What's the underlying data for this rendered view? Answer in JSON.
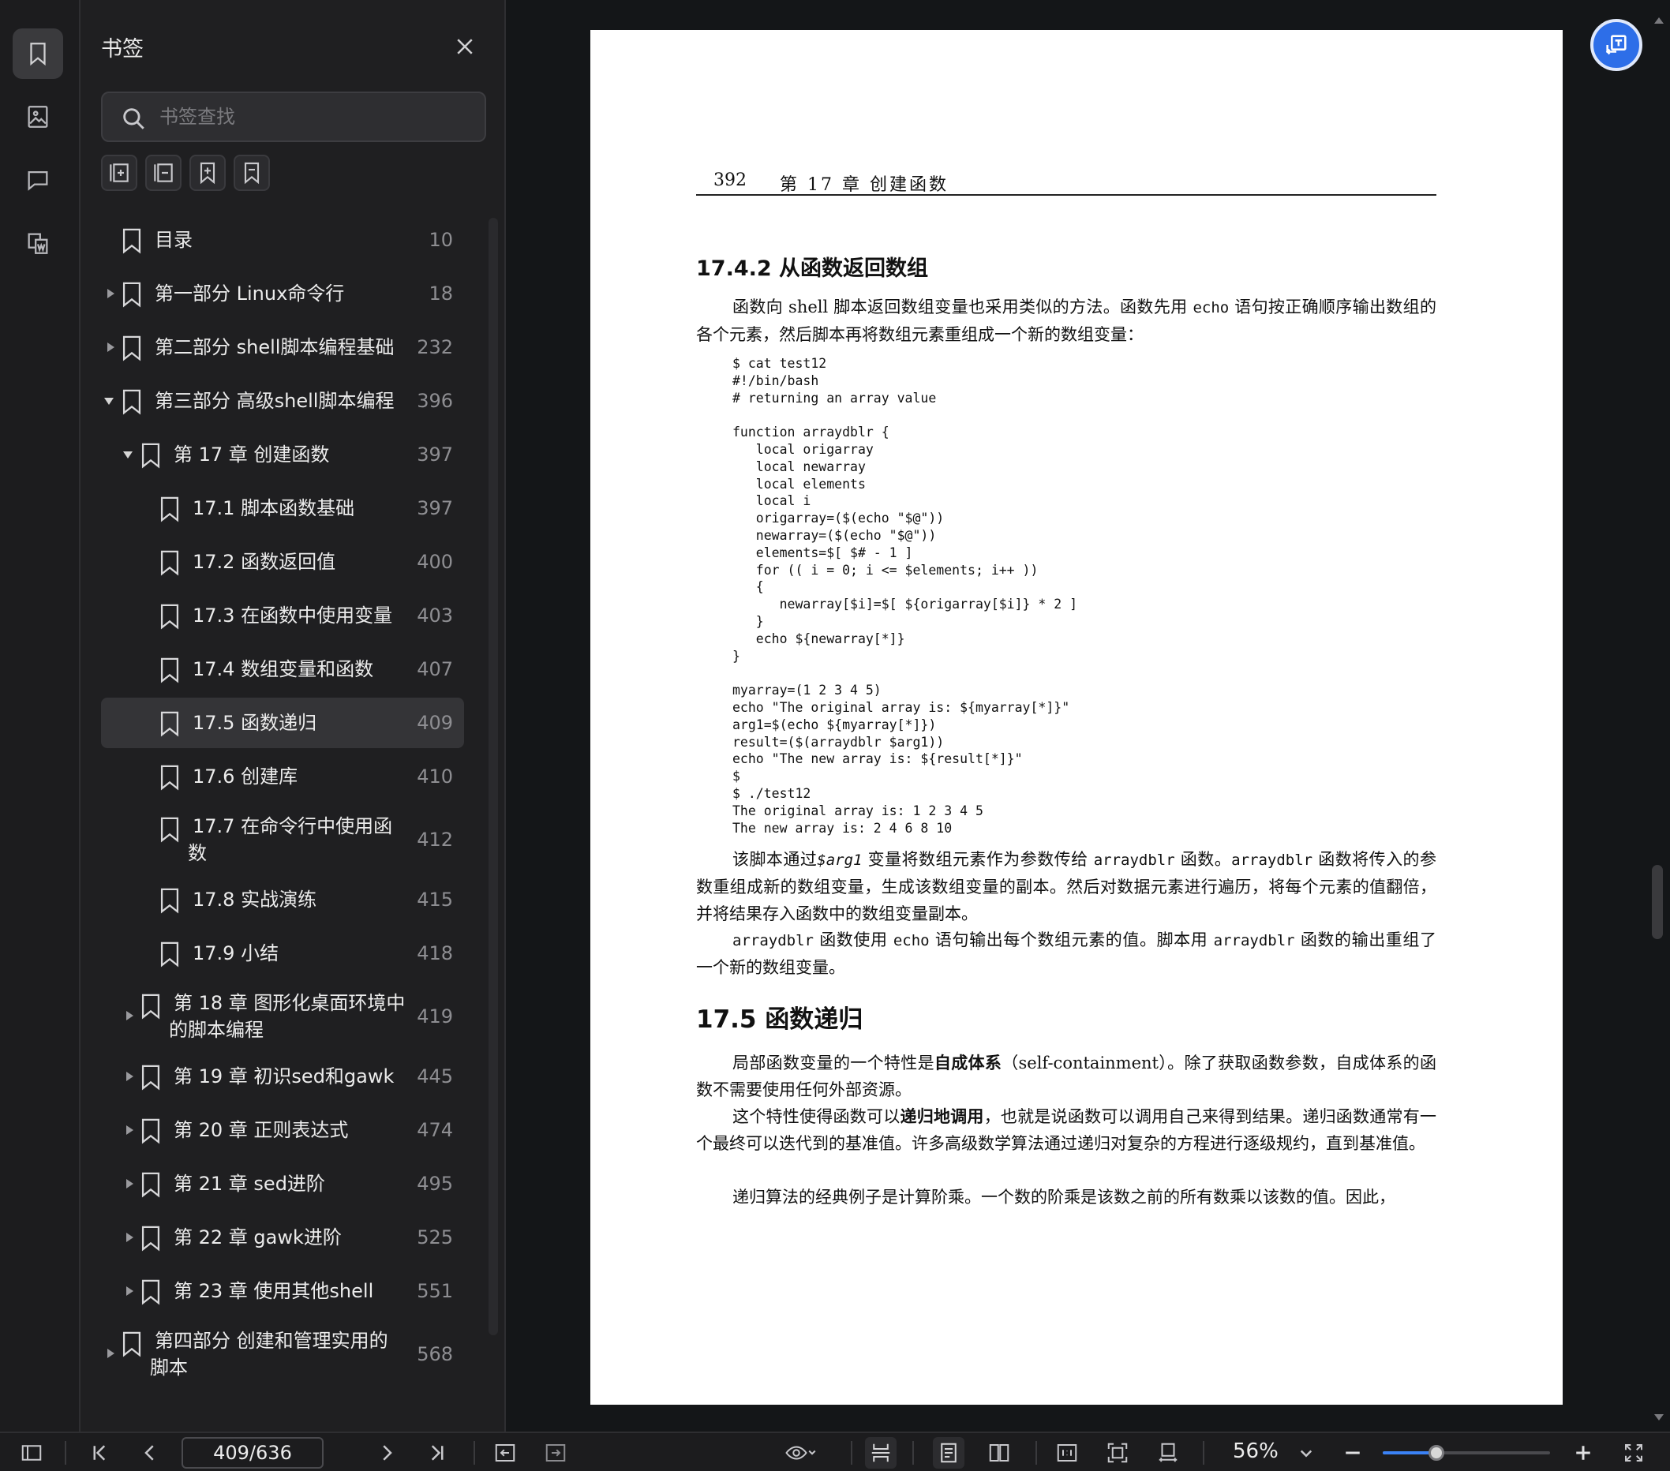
{
  "panel": {
    "title": "书签",
    "search_placeholder": "书签查找"
  },
  "bookmarks": [
    {
      "label": "目录",
      "page": "10",
      "level": 0,
      "arrow": "none"
    },
    {
      "label": "第一部分 Linux命令行",
      "page": "18",
      "level": 0,
      "arrow": "right"
    },
    {
      "label": " 第二部分 shell脚本编程基础",
      "page": "232",
      "level": 0,
      "arrow": "right"
    },
    {
      "label": " 第三部分 高级shell脚本编程",
      "page": "396",
      "level": 0,
      "arrow": "down"
    },
    {
      "label": "第 17 章 创建函数",
      "page": "397",
      "level": 1,
      "arrow": "down"
    },
    {
      "label": "17.1 脚本函数基础",
      "page": "397",
      "level": 2,
      "arrow": "none"
    },
    {
      "label": "17.2 函数返回值",
      "page": "400",
      "level": 2,
      "arrow": "none"
    },
    {
      "label": "17.3 在函数中使用变量",
      "page": "403",
      "level": 2,
      "arrow": "none"
    },
    {
      "label": "17.4 数组变量和函数",
      "page": "407",
      "level": 2,
      "arrow": "none"
    },
    {
      "label": "17.5 函数递归",
      "page": "409",
      "level": 2,
      "arrow": "none",
      "selected": true
    },
    {
      "label": "17.6 创建库",
      "page": "410",
      "level": 2,
      "arrow": "none"
    },
    {
      "label": "17.7 在命令行中使用函",
      "label2": "数",
      "page": "412",
      "level": 2,
      "arrow": "none"
    },
    {
      "label": "17.8 实战演练",
      "page": "415",
      "level": 2,
      "arrow": "none"
    },
    {
      "label": "17.9 小结",
      "page": "418",
      "level": 2,
      "arrow": "none"
    },
    {
      "label": "第 18 章 图形化桌面环境中",
      "label2": "的脚本编程",
      "page": "419",
      "level": 1,
      "arrow": "right"
    },
    {
      "label": "第 19 章 初识sed和gawk",
      "page": "445",
      "level": 1,
      "arrow": "right"
    },
    {
      "label": "第 20 章 正则表达式",
      "page": "474",
      "level": 1,
      "arrow": "right"
    },
    {
      "label": "第 21 章 sed进阶",
      "page": "495",
      "level": 1,
      "arrow": "right"
    },
    {
      "label": "第 22 章 gawk进阶",
      "page": "525",
      "level": 1,
      "arrow": "right"
    },
    {
      "label": "第 23 章 使用其他shell",
      "page": "551",
      "level": 1,
      "arrow": "right"
    },
    {
      "label": " 第四部分 创建和管理实用的",
      "label2": "脚本",
      "page": "568",
      "level": 0,
      "arrow": "right"
    }
  ],
  "document": {
    "page_number": "392",
    "chapter_header": "第 17 章  创建函数",
    "section1_title": "17.4.2   从函数返回数组",
    "p1_a": "函数向 shell 脚本返回数组变量也采用类似的方法。函数先用 ",
    "p1_code": "echo",
    "p1_b": " 语句按正确顺序输出数组的各个元素，然后脚本再将数组元素重组成一个新的数组变量：",
    "code": "$ cat test12\n#!/bin/bash\n# returning an array value\n\nfunction arraydblr {\n   local origarray\n   local newarray\n   local elements\n   local i\n   origarray=($(echo \"$@\"))\n   newarray=($(echo \"$@\"))\n   elements=$[ $# - 1 ]\n   for (( i = 0; i <= $elements; i++ ))\n   {\n      newarray[$i]=$[ ${origarray[$i]} * 2 ]\n   }\n   echo ${newarray[*]}\n}\n\nmyarray=(1 2 3 4 5)\necho \"The original array is: ${myarray[*]}\"\narg1=$(echo ${myarray[*]})\nresult=($(arraydblr $arg1))\necho \"The new array is: ${result[*]}\"\n$\n$ ./test12\nThe original array is: 1 2 3 4 5\nThe new array is: 2 4 6 8 10",
    "p2_a": "该脚本通过",
    "p2_var": "$arg1",
    "p2_b": " 变量将数组元素作为参数传给 ",
    "p2_code1": "arraydblr",
    "p2_c": " 函数。",
    "p2_code2": "arraydblr",
    "p2_d": " 函数将传入的参数重组成新的数组变量，生成该数组变量的副本。然后对数据元素进行遍历，将每个元素的值翻倍，并将结果存入函数中的数组变量副本。",
    "p3_code1": "arraydblr",
    "p3_a": " 函数使用 ",
    "p3_code2": "echo",
    "p3_b": " 语句输出每个数组元素的值。脚本用 ",
    "p3_code3": "arraydblr",
    "p3_c": " 函数的输出重组了一个新的数组变量。",
    "section2_title": "17.5   函数递归",
    "p4_a": "局部函数变量的一个特性是",
    "p4_bold": "自成体系",
    "p4_b": "（self-containment）。除了获取函数参数，自成体系的函数不需要使用任何外部资源。",
    "p5_a": "这个特性使得函数可以",
    "p5_bold": "递归地调用",
    "p5_b": "，也就是说函数可以调用自己来得到结果。递归函数通常有一个最终可以迭代到的基准值。许多高级数学算法通过递归对复杂的方程进行逐级规约，直到基准值。",
    "p6": "递归算法的经典例子是计算阶乘。一个数的阶乘是该数之前的所有数乘以该数的值。因此，"
  },
  "toolbar": {
    "page_indicator": "409/636",
    "zoom": "56%",
    "zoom_level": 0.32
  }
}
